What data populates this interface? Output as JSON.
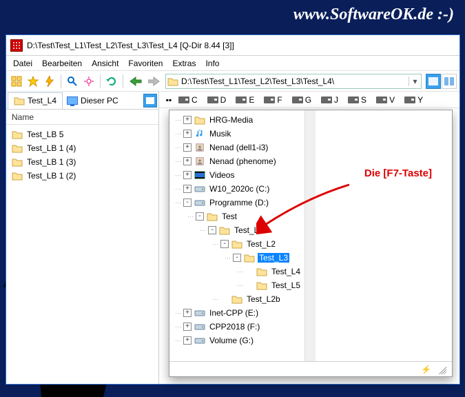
{
  "watermark": "www.SoftwareOK.de :-)",
  "window": {
    "title": "D:\\Test\\Test_L1\\Test_L2\\Test_L3\\Test_L4  [Q-Dir 8.44 [3]]"
  },
  "menu": {
    "datei": "Datei",
    "bearbeiten": "Bearbeiten",
    "ansicht": "Ansicht",
    "favoriten": "Favoriten",
    "extras": "Extras",
    "info": "Info"
  },
  "address": {
    "path": "D:\\Test\\Test_L1\\Test_L2\\Test_L3\\Test_L4\\"
  },
  "tabs": {
    "active": "Test_L4",
    "this_pc": "Dieser PC"
  },
  "list": {
    "header_name": "Name",
    "items": [
      "Test_LB 5",
      "Test_LB 1 (4)",
      "Test_LB 1 (3)",
      "Test_LB 1 (2)"
    ]
  },
  "drives": {
    "items": [
      "C",
      "D",
      "E",
      "F",
      "G",
      "J",
      "S",
      "V",
      "Y"
    ]
  },
  "tree": {
    "nodes": [
      {
        "indent": 1,
        "exp": "+",
        "icon": "folder",
        "label": "HRG-Media"
      },
      {
        "indent": 1,
        "exp": "+",
        "icon": "music",
        "label": "Musik"
      },
      {
        "indent": 1,
        "exp": "+",
        "icon": "contact",
        "label": "Nenad (dell1-i3)"
      },
      {
        "indent": 1,
        "exp": "+",
        "icon": "contact",
        "label": "Nenad (phenome)"
      },
      {
        "indent": 1,
        "exp": "+",
        "icon": "video",
        "label": "Videos"
      },
      {
        "indent": 1,
        "exp": "+",
        "icon": "drive",
        "label": "W10_2020c (C:)"
      },
      {
        "indent": 1,
        "exp": "-",
        "icon": "drive",
        "label": "Programme (D:)"
      },
      {
        "indent": 2,
        "exp": "-",
        "icon": "folder",
        "label": "Test"
      },
      {
        "indent": 3,
        "exp": "-",
        "icon": "folder",
        "label": "Test_L1"
      },
      {
        "indent": 4,
        "exp": "-",
        "icon": "folder",
        "label": "Test_L2"
      },
      {
        "indent": 5,
        "exp": "-",
        "icon": "folder",
        "label": "Test_L3",
        "selected": true
      },
      {
        "indent": 6,
        "exp": "",
        "icon": "folder",
        "label": "Test_L4"
      },
      {
        "indent": 6,
        "exp": "",
        "icon": "folder",
        "label": "Test_L5"
      },
      {
        "indent": 4,
        "exp": "",
        "icon": "folder",
        "label": "Test_L2b"
      },
      {
        "indent": 1,
        "exp": "+",
        "icon": "drive",
        "label": "Inet-CPP (E:)"
      },
      {
        "indent": 1,
        "exp": "+",
        "icon": "drive",
        "label": "CPP2018 (F:)"
      },
      {
        "indent": 1,
        "exp": "+",
        "icon": "drive",
        "label": "Volume (G:)"
      }
    ]
  },
  "callout": "Die [F7-Taste]"
}
